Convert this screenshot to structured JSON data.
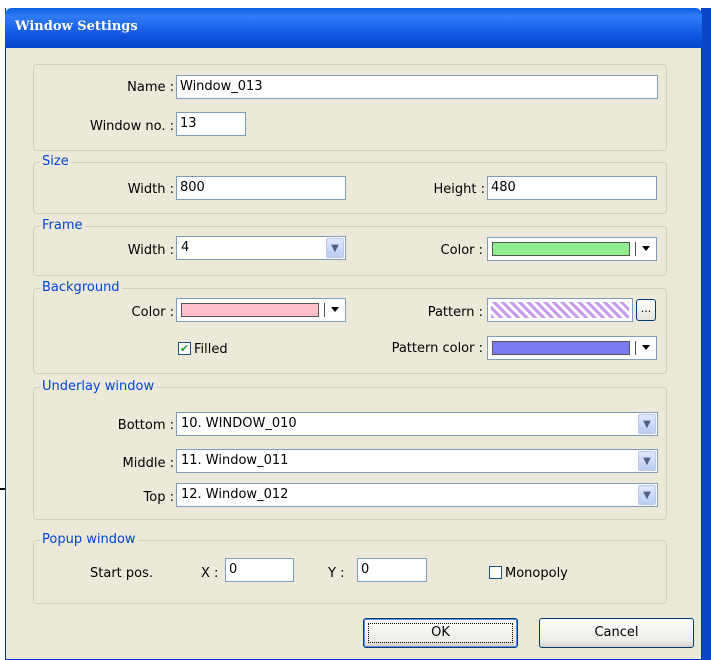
{
  "window": {
    "title": "Window Settings"
  },
  "general": {
    "name_label": "Name :",
    "name_value": "Window_013",
    "window_no_label": "Window no. :",
    "window_no_value": "13"
  },
  "size": {
    "legend": "Size",
    "width_label": "Width :",
    "width_value": "800",
    "height_label": "Height :",
    "height_value": "480"
  },
  "frame": {
    "legend": "Frame",
    "width_label": "Width :",
    "width_value": "4",
    "color_label": "Color :",
    "color": "#90ee90"
  },
  "background": {
    "legend": "Background",
    "color_label": "Color :",
    "color": "#ffc0cb",
    "pattern_label": "Pattern :",
    "pattern_button": "...",
    "filled_label": "Filled",
    "filled_checked": "✔",
    "pattern_color_label": "Pattern color :",
    "pattern_color": "#7b7bf0"
  },
  "underlay": {
    "legend": "Underlay window",
    "bottom_label": "Bottom :",
    "bottom_value": "10. WINDOW_010",
    "middle_label": "Middle :",
    "middle_value": "11. Window_011",
    "top_label": "Top :",
    "top_value": "12. Window_012"
  },
  "popup": {
    "legend": "Popup window",
    "start_pos_label": "Start pos.",
    "x_label": "X :",
    "x_value": "0",
    "y_label": "Y :",
    "y_value": "0",
    "monopoly_label": "Monopoly"
  },
  "buttons": {
    "ok": "OK",
    "cancel": "Cancel"
  },
  "icons": {
    "dropdown": "▼"
  }
}
